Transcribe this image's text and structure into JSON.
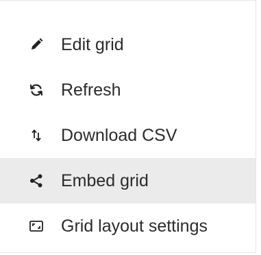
{
  "menu": {
    "items": [
      {
        "label": "Edit grid",
        "icon": "pencil-icon"
      },
      {
        "label": "Refresh",
        "icon": "refresh-icon"
      },
      {
        "label": "Download CSV",
        "icon": "sort-arrows-icon"
      },
      {
        "label": "Embed grid",
        "icon": "share-icon"
      },
      {
        "label": "Grid layout settings",
        "icon": "layout-settings-icon"
      }
    ],
    "highlighted_item": "Embed grid",
    "colors": {
      "text": "#2b2b2b",
      "highlight": "#ebebeb",
      "border": "#e6e6e6"
    }
  }
}
